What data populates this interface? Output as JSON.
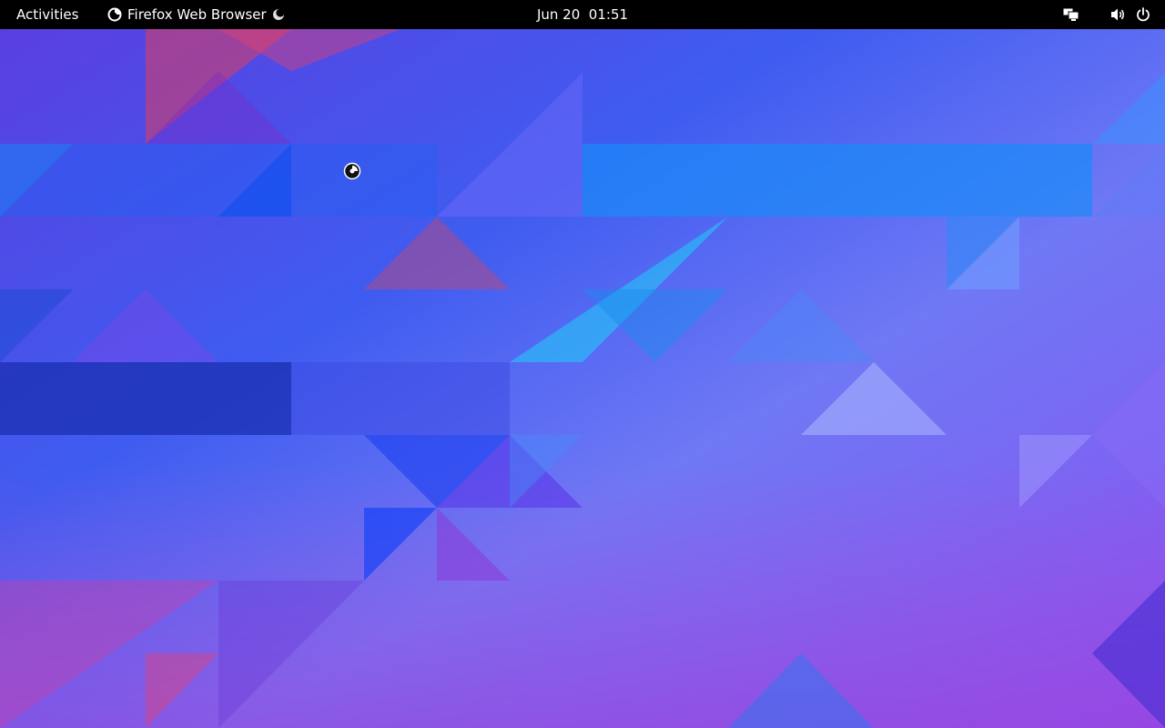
{
  "topbar": {
    "activities_label": "Activities",
    "app_name": "Firefox Web Browser",
    "date": "Jun 20",
    "time": "01:51",
    "icons": {
      "app": "firefox-icon",
      "loading": "spinner-icon",
      "network": "network-icon",
      "volume": "volume-icon",
      "power": "power-icon"
    }
  },
  "desktop": {
    "wallpaper": "geometric-triangles",
    "colors": {
      "bar": "#000000",
      "bar_text": "#ffffff",
      "blue": "#1e6ff0",
      "violet": "#7a4ff0",
      "magenta": "#a03ab8",
      "cyan": "#1ed0f8",
      "navy": "#0a2aa0"
    }
  }
}
